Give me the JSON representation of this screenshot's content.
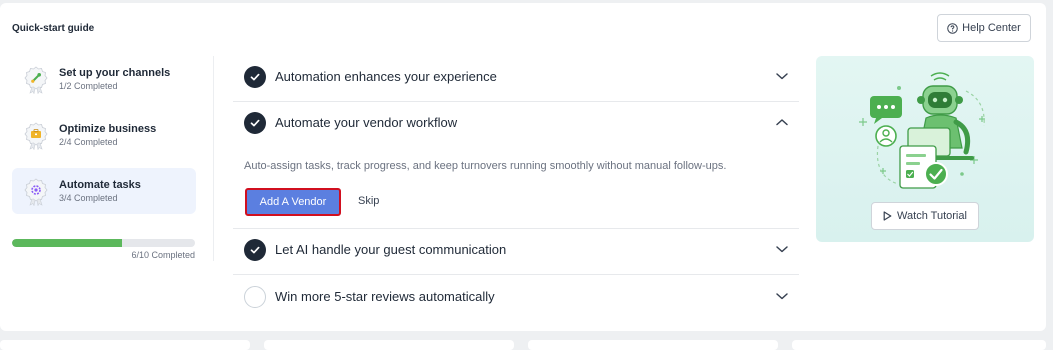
{
  "guide": {
    "title": "Quick-start guide",
    "help_label": "Help Center"
  },
  "steps": [
    {
      "title": "Set up your channels",
      "subtitle": "1/2 Completed",
      "icon": "plug-badge-icon",
      "active": false
    },
    {
      "title": "Optimize business",
      "subtitle": "2/4 Completed",
      "icon": "briefcase-badge-icon",
      "active": false
    },
    {
      "title": "Automate tasks",
      "subtitle": "3/4 Completed",
      "icon": "gear-badge-icon",
      "active": true
    }
  ],
  "progress": {
    "value": 0.6,
    "label": "6/10 Completed",
    "color": "#5cb85c"
  },
  "accordion": [
    {
      "title": "Automation enhances your experience",
      "done": true,
      "expanded": false
    },
    {
      "title": "Automate your vendor workflow",
      "done": true,
      "expanded": true,
      "description": "Auto-assign tasks, track progress, and keep turnovers running smoothly without manual follow-ups.",
      "primary_label": "Add A Vendor",
      "secondary_label": "Skip"
    },
    {
      "title": "Let AI handle your guest communication",
      "done": true,
      "expanded": false
    },
    {
      "title": "Win more 5-star reviews automatically",
      "done": false,
      "expanded": false
    }
  ],
  "promo": {
    "illustration": "robot-assistant-illustration",
    "watch_label": "Watch Tutorial"
  },
  "colors": {
    "accent": "#5b7fe0",
    "highlight_border": "#d10f1f",
    "active_step_bg": "#eef3fd",
    "promo_bg": "#dcf3f0"
  }
}
